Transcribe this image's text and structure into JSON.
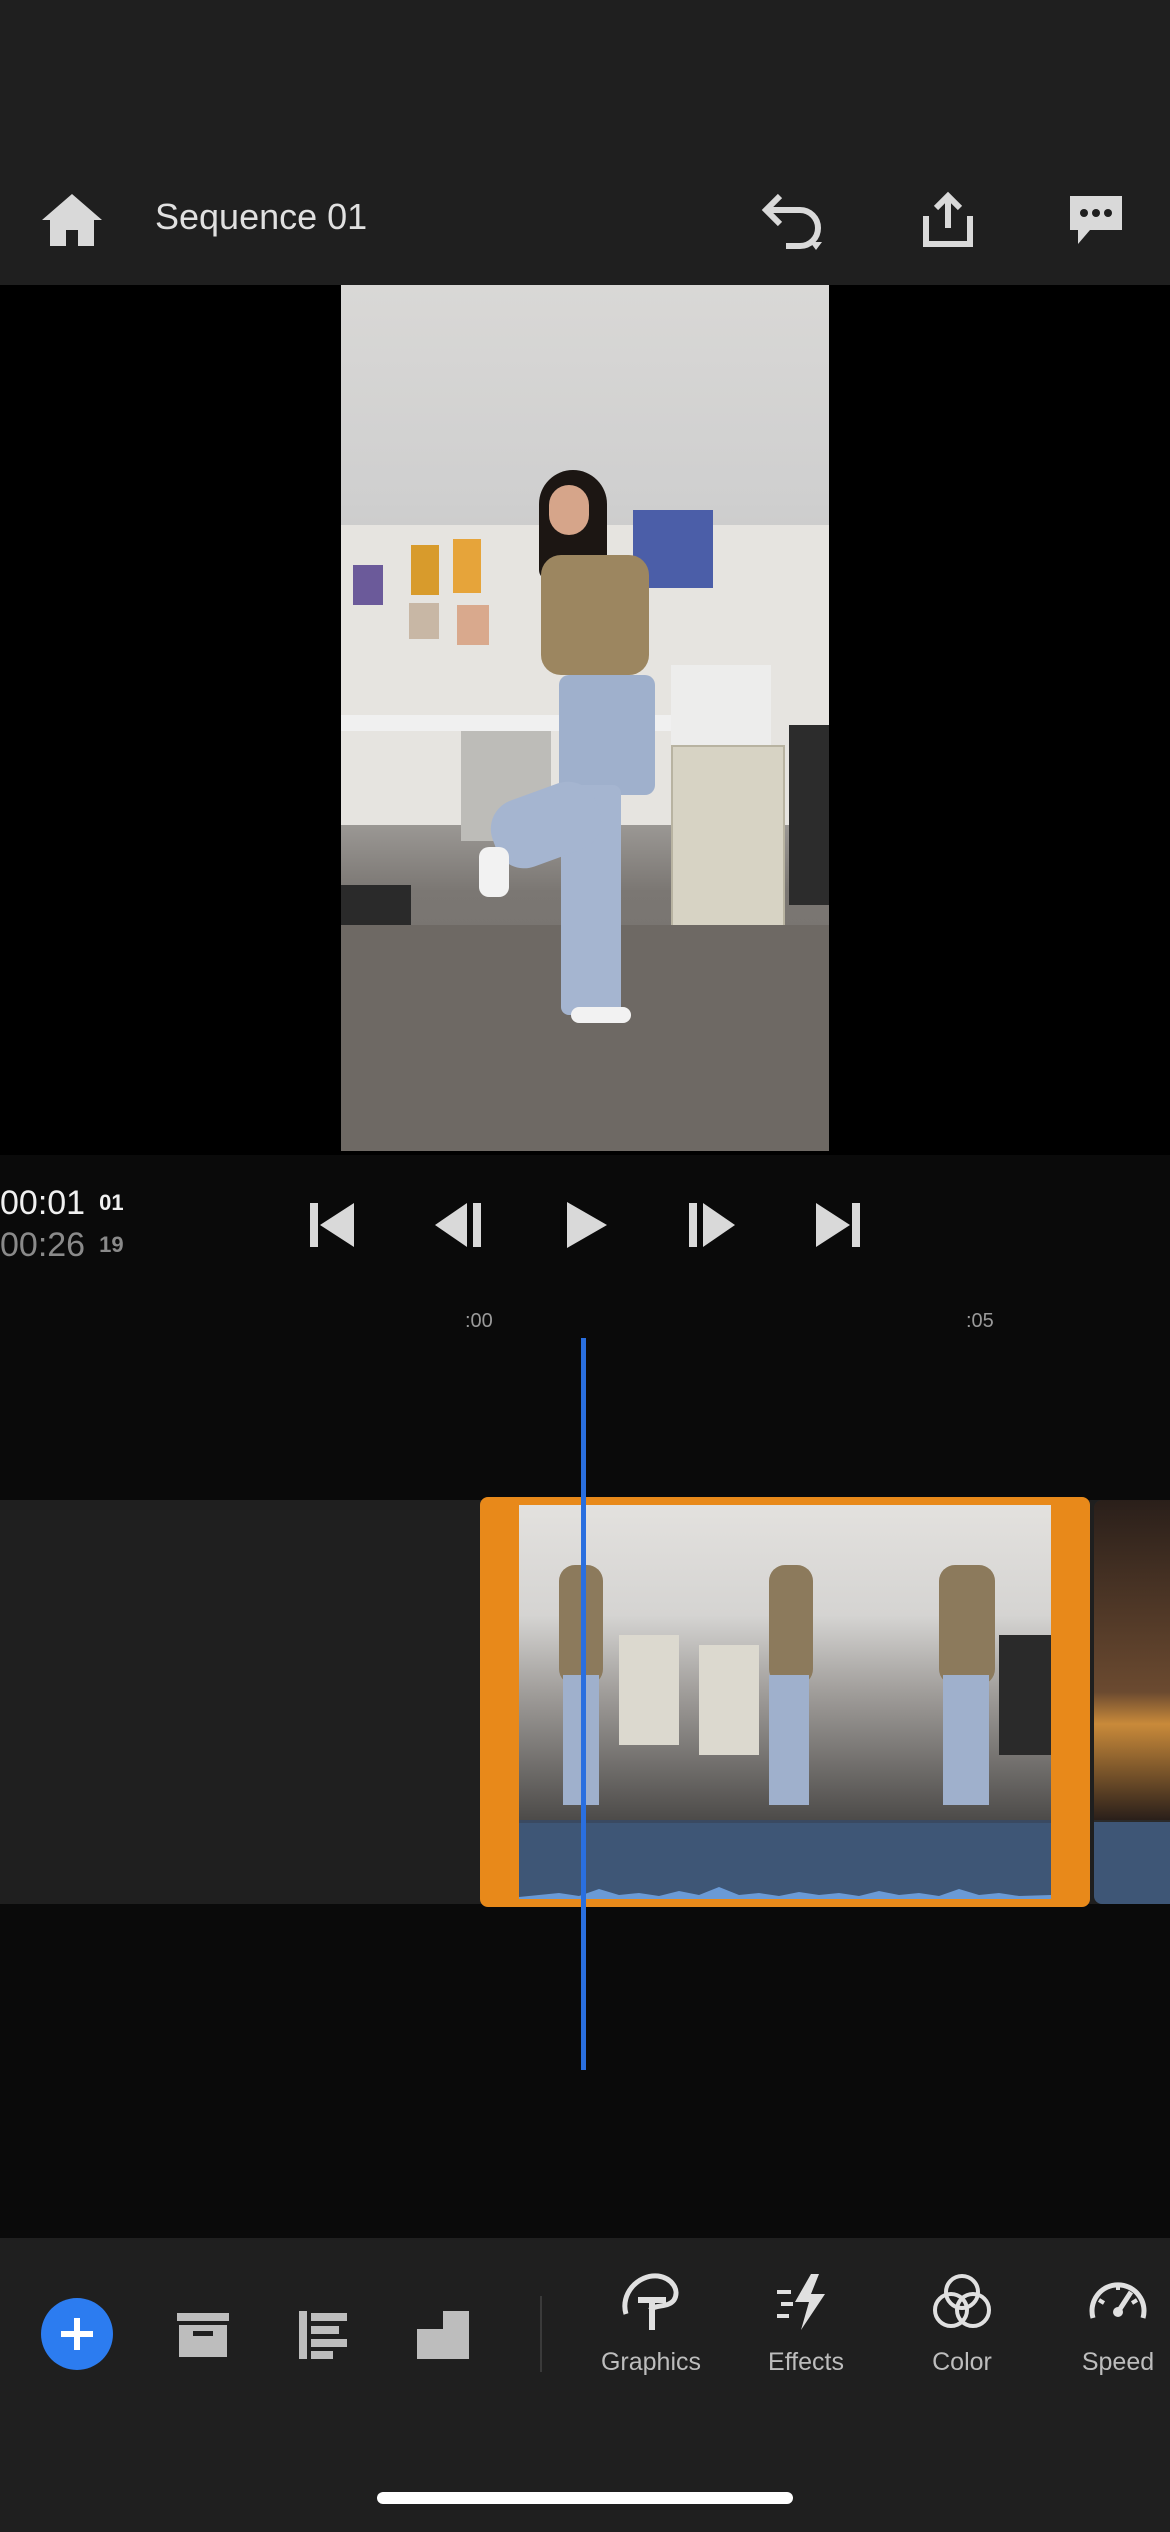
{
  "header": {
    "title": "Sequence 01",
    "icons": [
      "home-icon",
      "undo-icon",
      "share-icon",
      "feedback-icon"
    ]
  },
  "transport": {
    "current_time": "00:01",
    "current_frame": "01",
    "total_time": "00:26",
    "total_frame": "19",
    "icons": [
      "skip-to-start-icon",
      "step-back-icon",
      "play-icon",
      "step-forward-icon",
      "skip-to-end-icon"
    ]
  },
  "timeline": {
    "ticks": [
      ":00",
      ":05"
    ],
    "clip_color": "#e8891a",
    "playhead_color": "#2a6fdf"
  },
  "toolbar": {
    "add_icon": "plus-icon",
    "icons": [
      "archive-icon",
      "list-icon",
      "aspect-icon"
    ],
    "tools": [
      {
        "label": "Graphics",
        "icon": "graphics-icon"
      },
      {
        "label": "Effects",
        "icon": "effects-icon"
      },
      {
        "label": "Color",
        "icon": "color-icon"
      },
      {
        "label": "Speed",
        "icon": "speed-icon"
      }
    ],
    "accent": "#2c7cf0"
  }
}
